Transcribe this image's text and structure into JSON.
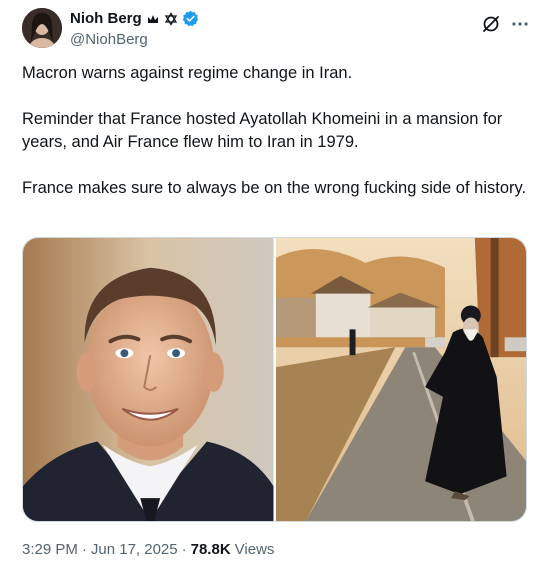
{
  "author": {
    "display_name": "Nioh Berg",
    "handle": "@NiohBerg",
    "icons": [
      "crown-icon",
      "star-of-david-icon",
      "verified-badge-icon"
    ],
    "verified_color": "#1d9bf0"
  },
  "header_actions": {
    "grok_icon": "grok-icon",
    "more_icon": "more-horizontal-icon"
  },
  "tweet": {
    "paragraphs": [
      "Macron warns against regime change in Iran.",
      "Reminder that France hosted Ayatollah Khomeini in a mansion for years, and Air France flew him to Iran in 1979.",
      "France makes sure to always be on the wrong fucking side of history."
    ]
  },
  "media": {
    "count": 2
  },
  "footer": {
    "time": "3:29 PM",
    "sep1": "·",
    "date": "Jun 17, 2025",
    "sep2": "·",
    "views_count": "78.8K",
    "views_label": "Views"
  },
  "colors": {
    "text": "#0f1419",
    "secondary": "#536471",
    "border": "#cfd9de"
  }
}
